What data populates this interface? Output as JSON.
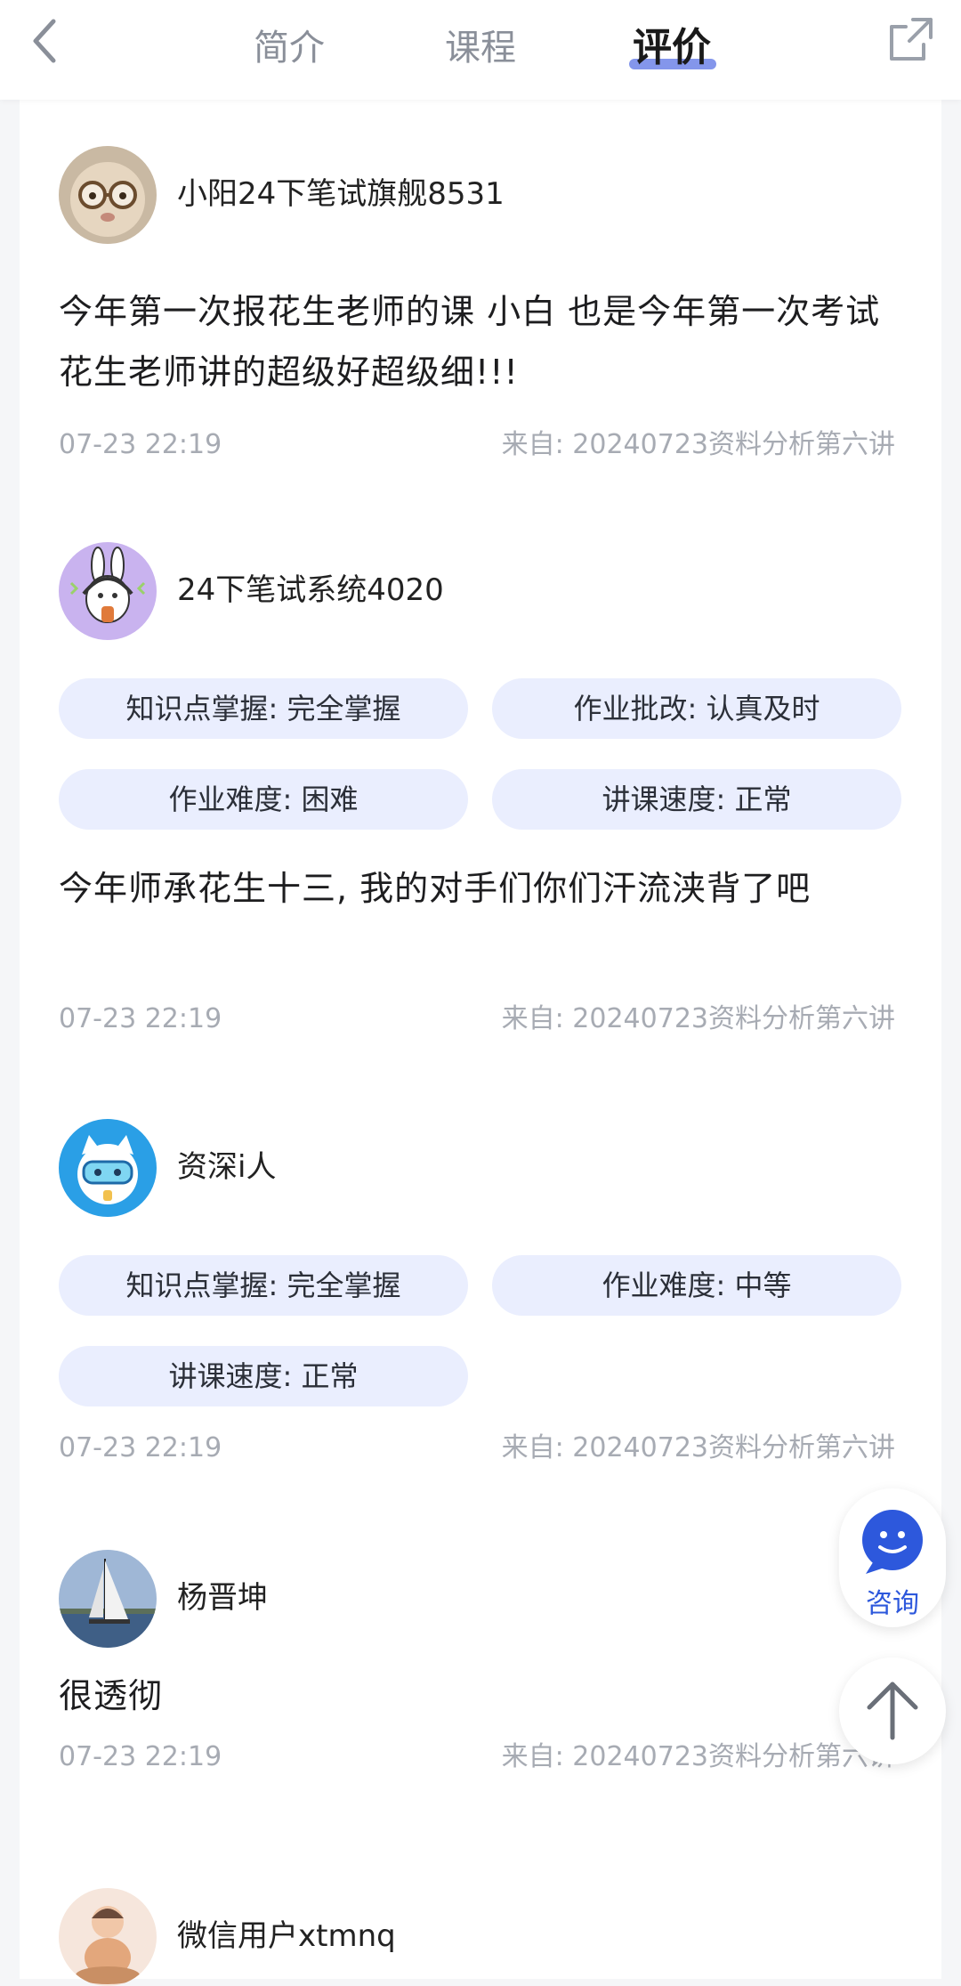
{
  "nav": {
    "tabs": [
      {
        "label": "简介",
        "active": false
      },
      {
        "label": "课程",
        "active": false
      },
      {
        "label": "评价",
        "active": true
      }
    ],
    "back_icon": "chevron-left-icon",
    "share_icon": "share-external-icon"
  },
  "reviews": [
    {
      "username": "小阳24下笔试旗舰8531",
      "avatar": "cat-with-glasses",
      "tags": [],
      "content": "今年第一次报花生老师的课 小白 也是今年第一次考试 花生老师讲的超级好超级细!!!",
      "time": "07-23 22:19",
      "source": "来自: 20240723资料分析第六讲"
    },
    {
      "username": "24下笔试系统4020",
      "avatar": "bunny-headphones",
      "tags": [
        "知识点掌握: 完全掌握",
        "作业批改: 认真及时",
        "作业难度: 困难",
        "讲课速度: 正常"
      ],
      "content": "今年师承花生十三, 我的对手们你们汗流浃背了吧",
      "time": "07-23 22:19",
      "source": "来自: 20240723资料分析第六讲"
    },
    {
      "username": "资深i人",
      "avatar": "cat-diving-mask",
      "tags": [
        "知识点掌握: 完全掌握",
        "作业难度: 中等",
        "讲课速度: 正常"
      ],
      "content": "",
      "time": "07-23 22:19",
      "source": "来自: 20240723资料分析第六讲"
    },
    {
      "username": "杨晋坤",
      "avatar": "sailboat-photo",
      "tags": [],
      "content": "很透彻",
      "time": "07-23 22:19",
      "source": "来自: 20240723资料分析第六讲"
    },
    {
      "username": "微信用户xtmnq",
      "avatar": "meditating-child",
      "tags": [],
      "content": "",
      "time": "",
      "source": ""
    }
  ],
  "floating": {
    "consult_label": "咨询",
    "consult_icon": "chat-face-icon",
    "back_to_top_icon": "arrow-up-icon"
  },
  "colors": {
    "accent": "#2d58dc",
    "tag_bg": "#eaeefe",
    "meta_text": "#a7abb3",
    "tab_indicator": "#6f84e8"
  }
}
